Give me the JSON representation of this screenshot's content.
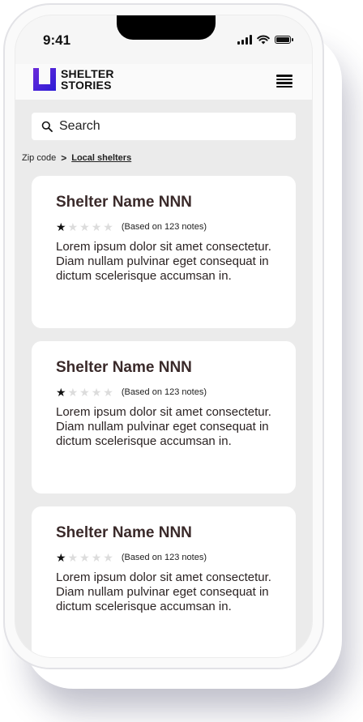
{
  "status_bar": {
    "time": "9:41"
  },
  "header": {
    "logo_line1": "SHELTER",
    "logo_line2": "STORIES",
    "brand_color_primary": "#2b1bd6",
    "brand_color_secondary": "#6b2bd9"
  },
  "search": {
    "placeholder": "Search"
  },
  "breadcrumb": {
    "parent": "Zip code",
    "separator": ">",
    "current": "Local shelters"
  },
  "cards": [
    {
      "title": "Shelter Name NNN",
      "rating": 1,
      "max_rating": 5,
      "rating_note": "(Based on 123 notes)",
      "description": "Lorem ipsum dolor sit amet consectetur. Diam nullam pulvinar eget consequat in dictum scelerisque accumsan in."
    },
    {
      "title": "Shelter Name NNN",
      "rating": 1,
      "max_rating": 5,
      "rating_note": "(Based on 123 notes)",
      "description": "Lorem ipsum dolor sit amet consectetur. Diam nullam pulvinar eget consequat in dictum scelerisque accumsan in."
    },
    {
      "title": "Shelter Name NNN",
      "rating": 1,
      "max_rating": 5,
      "rating_note": "(Based on 123 notes)",
      "description": "Lorem ipsum dolor sit amet consectetur. Diam nullam pulvinar eget consequat in dictum scelerisque accumsan in."
    }
  ],
  "icons": {
    "menu": "hamburger-menu-icon",
    "search": "search-icon",
    "star": "star-icon"
  }
}
